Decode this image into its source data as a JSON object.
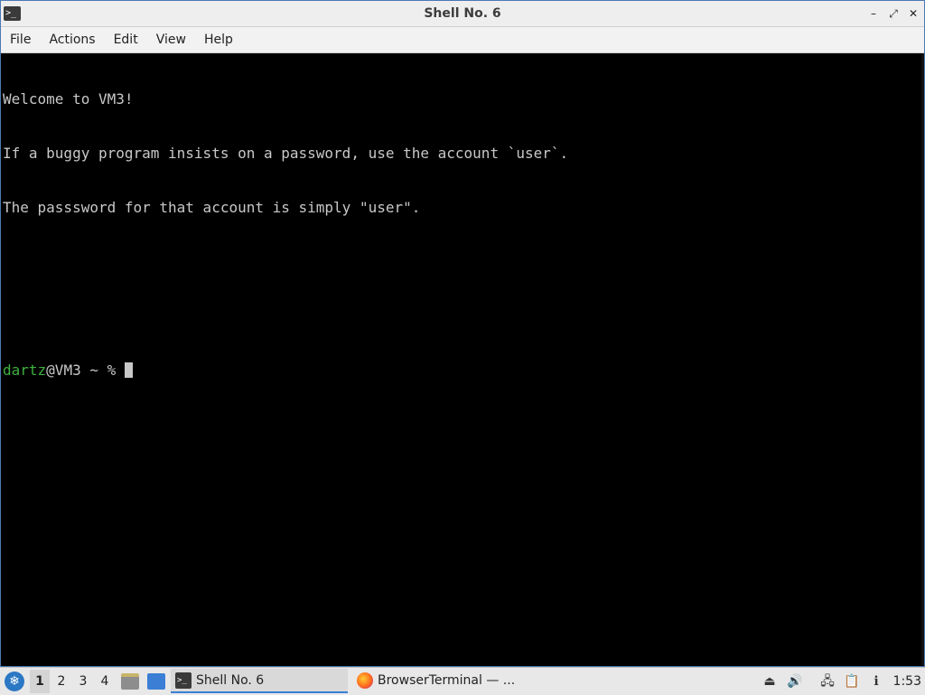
{
  "window": {
    "title": "Shell No. 6",
    "app_icon": "terminal-icon",
    "controls": {
      "minimize": "minimize-icon",
      "maximize": "maximize-icon",
      "close": "close-icon"
    }
  },
  "menu": {
    "items": [
      "File",
      "Actions",
      "Edit",
      "View",
      "Help"
    ]
  },
  "terminal": {
    "lines": [
      "Welcome to VM3!",
      "If a buggy program insists on a password, use the account `user`.",
      "The passsword for that account is simply \"user\".",
      "",
      ""
    ],
    "prompt": {
      "user": "dartz",
      "rest": "@VM3 ~ % "
    }
  },
  "taskbar": {
    "start_icon": "start-menu-icon",
    "desktops": [
      "1",
      "2",
      "3",
      "4"
    ],
    "active_desktop": "1",
    "quick_launch": [
      "file-manager-icon",
      "show-desktop-icon"
    ],
    "tasks": [
      {
        "label": "Shell No. 6",
        "icon": "terminal-icon",
        "active": true
      },
      {
        "label": "BrowserTerminal — ...",
        "icon": "firefox-icon",
        "active": false
      }
    ],
    "tray": [
      "removable-drive-icon",
      "volume-icon",
      "network-icon",
      "clipboard-icon",
      "update-notifier-icon"
    ],
    "clock": "1:53"
  },
  "colors": {
    "prompt_user": "#3fb03f",
    "terminal_bg": "#000000",
    "terminal_fg": "#c8c8c8",
    "accent": "#3a7fd5"
  }
}
